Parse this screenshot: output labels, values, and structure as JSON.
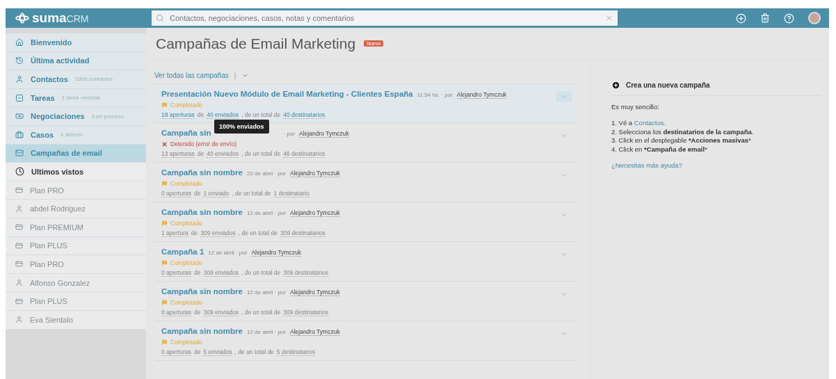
{
  "header": {
    "logo_main": "suma",
    "logo_sub": "CRM",
    "search": {
      "placeholder": "Contactos, negociaciones, casos, notas y comentarios"
    }
  },
  "sidebar": {
    "items": [
      {
        "kind": "home",
        "label": "Bienvenido",
        "selected": false
      },
      {
        "kind": "activity",
        "label": "Última actividad",
        "selected": false
      },
      {
        "kind": "person",
        "label": "Contactos",
        "note": "5369 contactos",
        "selected": false
      },
      {
        "kind": "check",
        "label": "Tareas",
        "note": "1 tarea vencida",
        "selected": false
      },
      {
        "kind": "money",
        "label": "Negociaciones",
        "note": "9 en proceso",
        "selected": false
      },
      {
        "kind": "case",
        "label": "Casos",
        "note": "1 abierto",
        "selected": false
      },
      {
        "kind": "email",
        "label": "Campañas de email",
        "selected": true
      }
    ],
    "recent_title": "Ultimos vistos",
    "recent": [
      {
        "kind": "deal",
        "label": "Plan PRO"
      },
      {
        "kind": "person",
        "label": "abdel Rodriguez"
      },
      {
        "kind": "deal",
        "label": "Plan PREMIUM"
      },
      {
        "kind": "deal",
        "label": "Plan PLUS"
      },
      {
        "kind": "deal",
        "label": "Plan PRO"
      },
      {
        "kind": "person",
        "label": "Alfonso Gonzalez"
      },
      {
        "kind": "deal",
        "label": "Plan PLUS"
      },
      {
        "kind": "person",
        "label": "Eva Sientalo"
      }
    ]
  },
  "page": {
    "title": "Campañas de Email Marketing",
    "badge": "Nuevo",
    "filter": "Ver todas las campañas",
    "separator": "|"
  },
  "campaigns": [
    {
      "title": "Presentación Nuevo Módulo de Email Marketing - Clientes España",
      "meta": "11:54 hs. · por",
      "author": "Alejandro Tymczuk",
      "status": {
        "kind": "completed",
        "label": "Completado"
      },
      "selected": true,
      "stats": [
        {
          "text": "18 aperturas",
          "kind": "link"
        },
        {
          "text": "de",
          "kind": "text"
        },
        {
          "text": "40 enviados",
          "kind": "link"
        },
        {
          "text": ", de un total de",
          "kind": "text"
        },
        {
          "text": "40 destinatarios",
          "kind": "link"
        }
      ],
      "tooltip": "100% enviados"
    },
    {
      "title": "Campaña sin",
      "meta": "· por",
      "author": "Alejandro Tymczuk",
      "status": {
        "kind": "stopped",
        "label": "Detenido (error de envío)"
      },
      "selected": false,
      "stats": [
        {
          "text": "13 aperturas",
          "kind": "link"
        },
        {
          "text": "de",
          "kind": "text"
        },
        {
          "text": "40 enviados",
          "kind": "link"
        },
        {
          "text": ", de un total de",
          "kind": "text"
        },
        {
          "text": "46 destinatarios",
          "kind": "link"
        }
      ]
    },
    {
      "title": "Campaña sin nombre",
      "meta": "22 de abril · por",
      "author": "Alejandro Tymczuk",
      "status": {
        "kind": "completed",
        "label": "Completado"
      },
      "selected": false,
      "stats": [
        {
          "text": "0 aperturas",
          "kind": "link"
        },
        {
          "text": "de",
          "kind": "text"
        },
        {
          "text": "1 enviado",
          "kind": "link"
        },
        {
          "text": ", de un total de",
          "kind": "text"
        },
        {
          "text": "1 destinatario",
          "kind": "link"
        }
      ]
    },
    {
      "title": "Campaña sin nombre",
      "meta": "12 de abril · por",
      "author": "Alejandro Tymczuk",
      "status": {
        "kind": "completed",
        "label": "Completado"
      },
      "selected": false,
      "stats": [
        {
          "text": "1 apertura",
          "kind": "link"
        },
        {
          "text": "de",
          "kind": "text"
        },
        {
          "text": "309 enviados",
          "kind": "link"
        },
        {
          "text": ", de un total de",
          "kind": "text"
        },
        {
          "text": "309 destinatarios",
          "kind": "link"
        }
      ]
    },
    {
      "title": "Campaña 1",
      "meta": "12 de abril · por",
      "author": "Alejandro Tymczuk",
      "status": {
        "kind": "completed",
        "label": "Completado"
      },
      "selected": false,
      "stats": [
        {
          "text": "0 aperturas",
          "kind": "link"
        },
        {
          "text": "de",
          "kind": "text"
        },
        {
          "text": "309 enviados",
          "kind": "link"
        },
        {
          "text": ", de un total de",
          "kind": "text"
        },
        {
          "text": "309 destinatarios",
          "kind": "link"
        }
      ]
    },
    {
      "title": "Campaña sin nombre",
      "meta": "12 de abril · por",
      "author": "Alejandro Tymczuk",
      "status": {
        "kind": "completed",
        "label": "Completado"
      },
      "selected": false,
      "stats": [
        {
          "text": "0 aperturas",
          "kind": "link"
        },
        {
          "text": "de",
          "kind": "text"
        },
        {
          "text": "309 enviados",
          "kind": "link"
        },
        {
          "text": ", de un total de",
          "kind": "text"
        },
        {
          "text": "309 destinatarios",
          "kind": "link"
        }
      ]
    },
    {
      "title": "Campaña sin nombre",
      "meta": "12 de abril · por",
      "author": "Alejandro Tymczuk",
      "status": {
        "kind": "completed",
        "label": "Completado"
      },
      "selected": false,
      "stats": [
        {
          "text": "0 aperturas",
          "kind": "link"
        },
        {
          "text": "de",
          "kind": "text"
        },
        {
          "text": "5 enviados",
          "kind": "link"
        },
        {
          "text": ", de un total de",
          "kind": "text"
        },
        {
          "text": "5 destinatarios",
          "kind": "link"
        }
      ]
    }
  ],
  "help": {
    "title": "Crea una nueva campaña",
    "intro": "Es muy sencillo:",
    "step1_text": "1. Vé a",
    "step1_link": "Contactos.",
    "steps": [
      "2. Selecciona los **destinatarios de la campaña**.",
      "3. Click en el desplegable ***Acciones masivas***",
      "4. Click en ***Campaña de email***"
    ],
    "more": "¿Necesitas más ayuda?"
  }
}
